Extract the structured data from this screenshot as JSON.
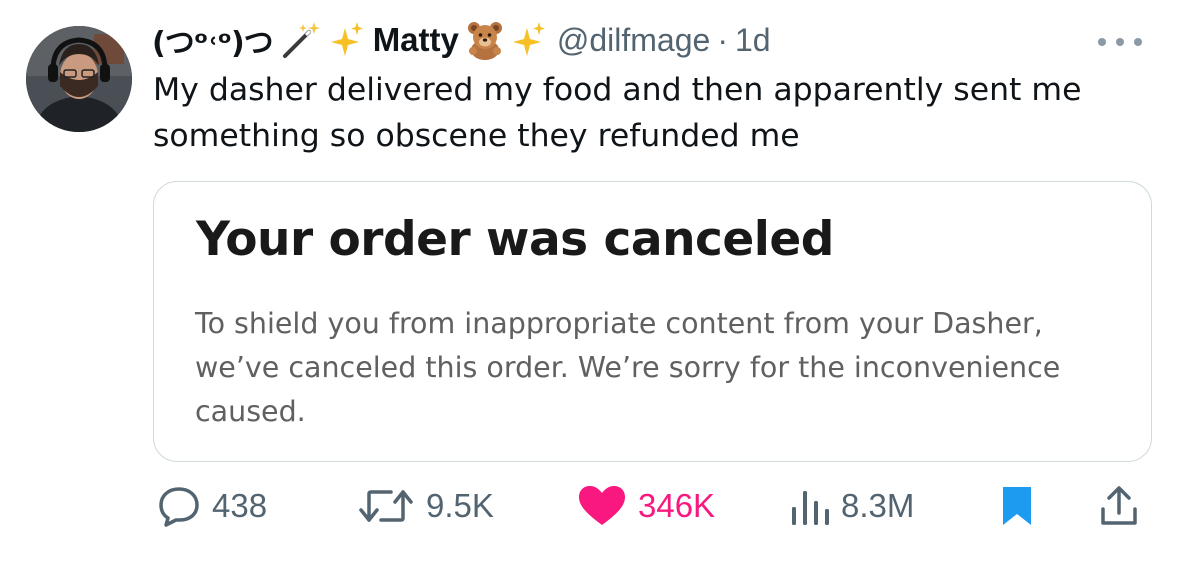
{
  "author": {
    "kaomoji": "(つᵒ˓ᵒ)つ",
    "display_name": "Matty",
    "handle": "@dilfmage",
    "separator": "·",
    "time": "1d",
    "avatar_icon": "avatar-photo"
  },
  "tweet": {
    "text": "My dasher delivered my food and then apparently sent me something so obscene they refunded me"
  },
  "card": {
    "title": "Your order was canceled",
    "body": "To shield you from inappropriate content from your Dasher, we’ve canceled this order. We’re sorry for the inconvenience caused."
  },
  "actions": {
    "replies": "438",
    "retweets": "9.5K",
    "likes": "346K",
    "views": "8.3M"
  },
  "colors": {
    "like": "#f91880",
    "bookmark": "#1d9bf0",
    "secondary_text": "#536471",
    "border": "#cfd9de"
  },
  "icons": [
    "more-icon",
    "reply-icon",
    "retweet-icon",
    "heart-icon",
    "views-icon",
    "bookmark-icon",
    "share-icon",
    "magic-wand-icon",
    "sparkles-icon",
    "teddy-bear-icon"
  ]
}
